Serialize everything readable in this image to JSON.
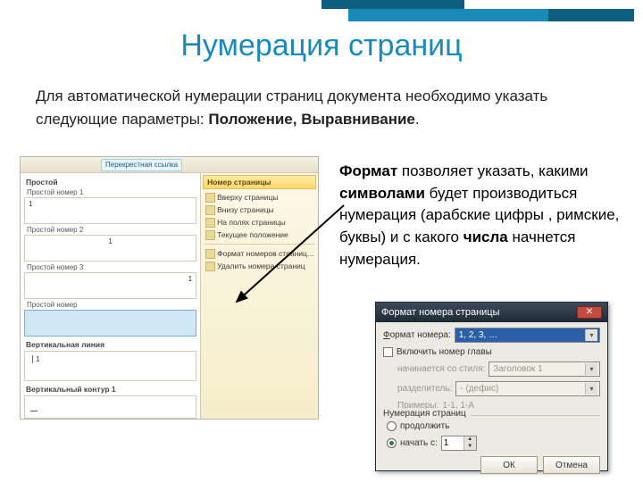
{
  "slide": {
    "title": "Нумерация страниц",
    "intro_plain": "Для автоматической нумерации страниц документа необходимо указать следующие параметры: ",
    "intro_bold": "Положение, Выравнивание",
    "intro_end": ".",
    "format_p1_b1": "Формат",
    "format_p1_t1": " позволяет указать, какими ",
    "format_p1_b2": "символами",
    "format_p1_t2": " будет производиться нумерация (арабские цифры , римские, буквы) и с какого ",
    "format_p1_b3": "числа",
    "format_p1_t3": " начнется нумерация."
  },
  "word": {
    "ribbon_chip_left": "",
    "ribbon_chip_right": "Перекрестная ссылка",
    "gallery_group1": "Простой",
    "items": [
      {
        "label": "Простой номер 1",
        "num_pos": "left"
      },
      {
        "label": "Простой номер 2",
        "num_pos": "center"
      },
      {
        "label": "Простой номер 3",
        "num_pos": "right"
      },
      {
        "label": "Простой номер",
        "selected": true,
        "num_pos": "left"
      }
    ],
    "gallery_group2": "Вертикальная линия",
    "gallery_group3": "Вертикальный контур 1",
    "menu_header": "Номер страницы",
    "menu": [
      "Вверху страницы",
      "Внизу страницы",
      "На полях страницы",
      "Текущее положение",
      "Формат номеров страниц...",
      "Удалить номера страниц"
    ]
  },
  "dialog": {
    "title": "Формат номера страницы",
    "format_label": "Формат номера:",
    "format_value": "1, 2, 3, …",
    "include_chapter": "Включить номер главы",
    "starts_style_label": "начинается со стиля:",
    "starts_style_value": "Заголовок 1",
    "separator_label": "разделитель:",
    "separator_value": "- (дефис)",
    "examples_label": "Примеры:",
    "examples_value": "1-1, 1-A",
    "group_title": "Нумерация страниц",
    "radio_continue": "продолжить",
    "radio_start": "начать с:",
    "start_value": "1",
    "ok": "ОК",
    "cancel": "Отмена"
  }
}
